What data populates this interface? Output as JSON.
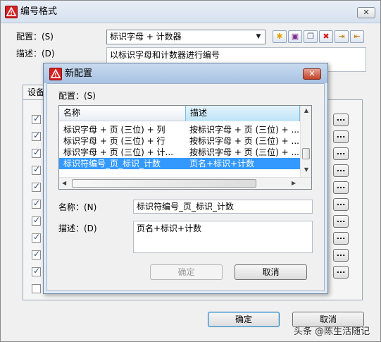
{
  "outer": {
    "title": "编号格式",
    "close": "✕",
    "config_label": "配置：(S)",
    "config_value": "标识字母 + 计数器",
    "desc_label": "描述：(D)",
    "desc_value": "以标识字母和计数器进行编号",
    "tab_label": "设备",
    "ok": "确定",
    "cancel": "取消",
    "checkboxes": [
      true,
      true,
      true,
      true,
      true,
      true,
      true,
      true,
      true,
      true,
      false
    ],
    "dots_label": "...",
    "toolbar": [
      "new-icon",
      "save-icon",
      "copy-icon",
      "delete-icon",
      "import-icon",
      "export-icon"
    ]
  },
  "inner": {
    "title": "新配置",
    "close": "✕",
    "config_label": "配置：(S)",
    "columns": [
      "名称",
      "描述"
    ],
    "rows": [
      {
        "name": "标识字母 + 页 (三位) + 列",
        "desc": "按标识字母 + 页 (三位) + ...",
        "selected": false
      },
      {
        "name": "标识字母 + 页 (三位) + 行",
        "desc": "按标识字母 + 页 (三位) + ...",
        "selected": false
      },
      {
        "name": "标识字母 + 页 (三位) + 计...",
        "desc": "按标识字母 + 页 (三位) + ...",
        "selected": false
      },
      {
        "name": "标识符编号_页_标识_计数",
        "desc": "页名+标识+计数",
        "selected": true
      }
    ],
    "name_label": "名称：(N)",
    "name_value": "标识符编号_页_标识_计数",
    "desc_label": "描述：(D)",
    "desc_value": "页名+标识+计数",
    "ok": "确定",
    "cancel": "取消"
  },
  "watermark": "头条 @陈生活随记"
}
